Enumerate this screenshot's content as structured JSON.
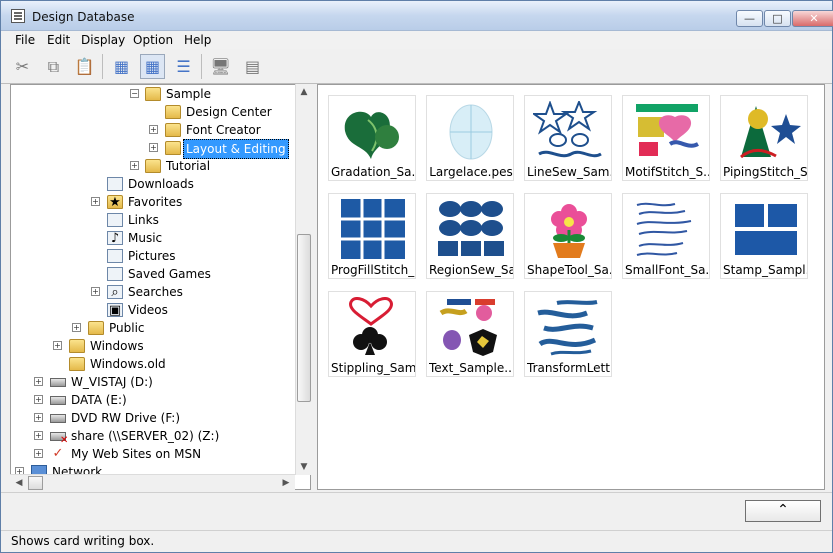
{
  "window": {
    "title": "Design Database",
    "minimize": "—",
    "maximize": "□",
    "close": "✕"
  },
  "menu": [
    "File",
    "Edit",
    "Display",
    "Option",
    "Help"
  ],
  "toolbar": {
    "cut": "✂",
    "copy": "⧉",
    "paste": "📋",
    "view1": "▦",
    "view2": "▦",
    "view3": "☰",
    "monitor": "🖥",
    "card": "▤"
  },
  "tree": [
    {
      "label": "Sample",
      "icon": "folder"
    },
    {
      "label": "Design Center",
      "icon": "folder"
    },
    {
      "label": "Font Creator",
      "icon": "folder"
    },
    {
      "label": "Layout & Editing",
      "icon": "folder"
    },
    {
      "label": "Tutorial",
      "icon": "folder"
    },
    {
      "label": "Downloads",
      "icon": "document"
    },
    {
      "label": "Favorites",
      "icon": "star-folder"
    },
    {
      "label": "Links",
      "icon": "document"
    },
    {
      "label": "Music",
      "icon": "music"
    },
    {
      "label": "Pictures",
      "icon": "document"
    },
    {
      "label": "Saved Games",
      "icon": "document"
    },
    {
      "label": "Searches",
      "icon": "search"
    },
    {
      "label": "Videos",
      "icon": "video"
    },
    {
      "label": "Public",
      "icon": "folder"
    },
    {
      "label": "Windows",
      "icon": "folder"
    },
    {
      "label": "Windows.old",
      "icon": "folder"
    },
    {
      "label": "W_VISTAJ (D:)",
      "icon": "drive"
    },
    {
      "label": "DATA (E:)",
      "icon": "drive"
    },
    {
      "label": "DVD RW Drive (F:)",
      "icon": "dvd"
    },
    {
      "label": "share (\\\\SERVER_02) (Z:)",
      "icon": "network-drive"
    },
    {
      "label": "My Web Sites on MSN",
      "icon": "web"
    },
    {
      "label": "Network",
      "icon": "network"
    }
  ],
  "items": [
    {
      "label": "Gradation_Sa..."
    },
    {
      "label": "Largelace.pes"
    },
    {
      "label": "LineSew_Sam..."
    },
    {
      "label": "MotifStitch_S..."
    },
    {
      "label": "PipingStitch_S..."
    },
    {
      "label": "ProgFillStitch_..."
    },
    {
      "label": "RegionSew_Sa..."
    },
    {
      "label": "ShapeTool_Sa..."
    },
    {
      "label": "SmallFont_Sa..."
    },
    {
      "label": "Stamp_Sampl..."
    },
    {
      "label": "Stippling_Sam..."
    },
    {
      "label": "Text_Sample...."
    },
    {
      "label": "TransformLett..."
    }
  ],
  "bottom": {
    "collapse": "⌃"
  },
  "status": "Shows card writing box."
}
